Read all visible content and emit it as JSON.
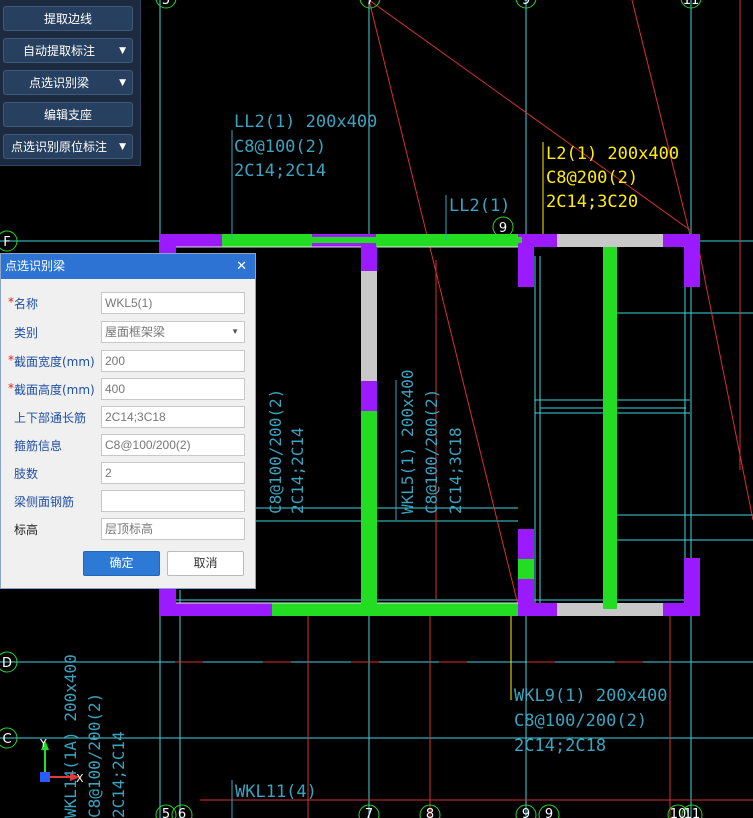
{
  "toolbar": {
    "items": [
      {
        "label": "提取边线",
        "has_menu": false
      },
      {
        "label": "自动提取标注",
        "has_menu": true
      },
      {
        "label": "点选识别梁",
        "has_menu": true
      },
      {
        "label": "编辑支座",
        "has_menu": false
      },
      {
        "label": "点选识别原位标注",
        "has_menu": true
      }
    ]
  },
  "dialog": {
    "title": "点选识别梁",
    "close_glyph": "✕",
    "fields": [
      {
        "label": "名称",
        "required": true,
        "value": "WKL5(1)",
        "type": "text",
        "plain_label": false
      },
      {
        "label": "类别",
        "required": false,
        "value": "屋面框架梁",
        "type": "select",
        "plain_label": false
      },
      {
        "label": "截面宽度(mm)",
        "required": true,
        "value": "200",
        "type": "text",
        "plain_label": false
      },
      {
        "label": "截面高度(mm)",
        "required": true,
        "value": "400",
        "type": "text",
        "plain_label": false
      },
      {
        "label": "上下部通长筋",
        "required": false,
        "value": "2C14;3C18",
        "type": "text",
        "plain_label": false
      },
      {
        "label": "箍筋信息",
        "required": false,
        "value": "C8@100/200(2)",
        "type": "text",
        "plain_label": false
      },
      {
        "label": "肢数",
        "required": false,
        "value": "2",
        "type": "text",
        "plain_label": false
      },
      {
        "label": "梁侧面钢筋",
        "required": false,
        "value": "",
        "type": "text",
        "plain_label": false
      },
      {
        "label": "标高",
        "required": false,
        "value": "层顶标高",
        "type": "text",
        "plain_label": true
      }
    ],
    "ok_label": "确定",
    "cancel_label": "取消"
  },
  "drawing": {
    "grid_axes": {
      "top": [
        "5",
        "7",
        "9",
        "11"
      ],
      "left": [
        "F",
        "D",
        "C"
      ],
      "bottom": [
        "5",
        "6",
        "7",
        "8",
        "9",
        "9",
        "10",
        "11"
      ],
      "mid": [
        "9"
      ]
    },
    "annotations": {
      "ll2_a": [
        "LL2(1) 200x400",
        "C8@100(2)",
        "2C14;2C14"
      ],
      "l2": [
        "L2(1) 200x400",
        "C8@200(2)",
        "2C14;3C20"
      ],
      "ll2_b": [
        "LL2(1)"
      ],
      "left_rot": [
        "C8@100/200(2)",
        "2C14;2C14"
      ],
      "wkl5": [
        "WKL5(1) 200x400",
        "C8@100/200(2)",
        "2C14;3C18"
      ],
      "wkl9": [
        "WKL9(1) 200x400",
        "C8@100/200(2)",
        "2C14;2C18"
      ],
      "wkl14": [
        "WKL14(1A) 200x400",
        "C8@100/200(2)",
        "2C14;2C14"
      ],
      "wkl11": [
        "WKL11(4)"
      ]
    },
    "ucs": {
      "x": "X",
      "y": "Y"
    },
    "colors": {
      "background": "#000000",
      "beam_green": "#22dd22",
      "support_purple": "#9c1aff",
      "support_gray": "#c8c8c8",
      "grid_cyan": "#3fd6e0",
      "axis_red": "#e03a3a",
      "label_cyan": "#3aa3c0",
      "label_yellow": "#ffee00",
      "axis_circle": "#2ad32a"
    }
  }
}
